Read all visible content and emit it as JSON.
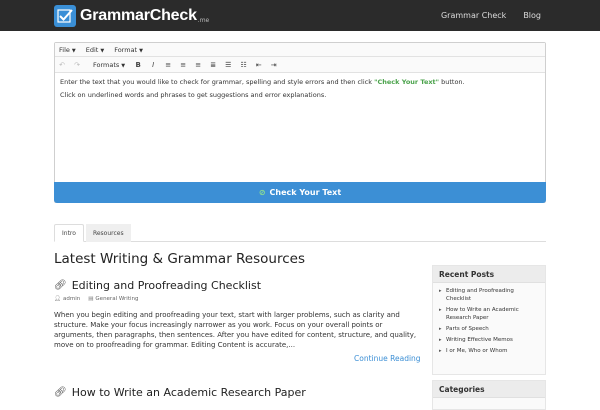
{
  "header": {
    "logo_text": "GrammarCheck",
    "logo_suffix": ".me",
    "nav": [
      "Grammar Check",
      "Blog"
    ]
  },
  "editor": {
    "menus": [
      "File",
      "Edit",
      "Format"
    ],
    "toolbar_formats": "Formats",
    "toolbar_buttons": [
      "B",
      "I"
    ],
    "content_line1_a": "Enter the text that you would like to check for grammar, spelling and style errors and then click ",
    "content_line1_hl": "\"Check Your Text\"",
    "content_line1_b": " button.",
    "content_line2": "Click on underlined words and phrases to get suggestions and error explanations.",
    "check_button": "Check Your Text"
  },
  "tabs": [
    "Intro",
    "Resources"
  ],
  "main": {
    "heading": "Latest Writing & Grammar Resources",
    "article": {
      "title": "Editing and Proofreading Checklist",
      "author": "admin",
      "category": "General Writing",
      "body": "When you begin editing and proofreading your text, start with larger problems, such as clarity and structure. Make your focus increasingly narrower as you work. Focus on your overall points or arguments, then paragraphs, then sentences. After you have edited for content, structure, and quality, move on to proofreading for grammar. Editing Content is accurate,...",
      "continue": "Continue Reading"
    },
    "article2_title": "How to Write an Academic Research Paper"
  },
  "sidebar": {
    "recent_title": "Recent Posts",
    "recent_posts": [
      "Editing and Proofreading Checklist",
      "How to Write an Academic Research Paper",
      "Parts of Speech",
      "Writing Effective Memos",
      "I or Me, Who or Whom"
    ],
    "categories_title": "Categories"
  },
  "colors": {
    "navbar": "#2b2b2b",
    "accent_blue": "#3c8fd5",
    "highlight_green": "#49a24a"
  }
}
